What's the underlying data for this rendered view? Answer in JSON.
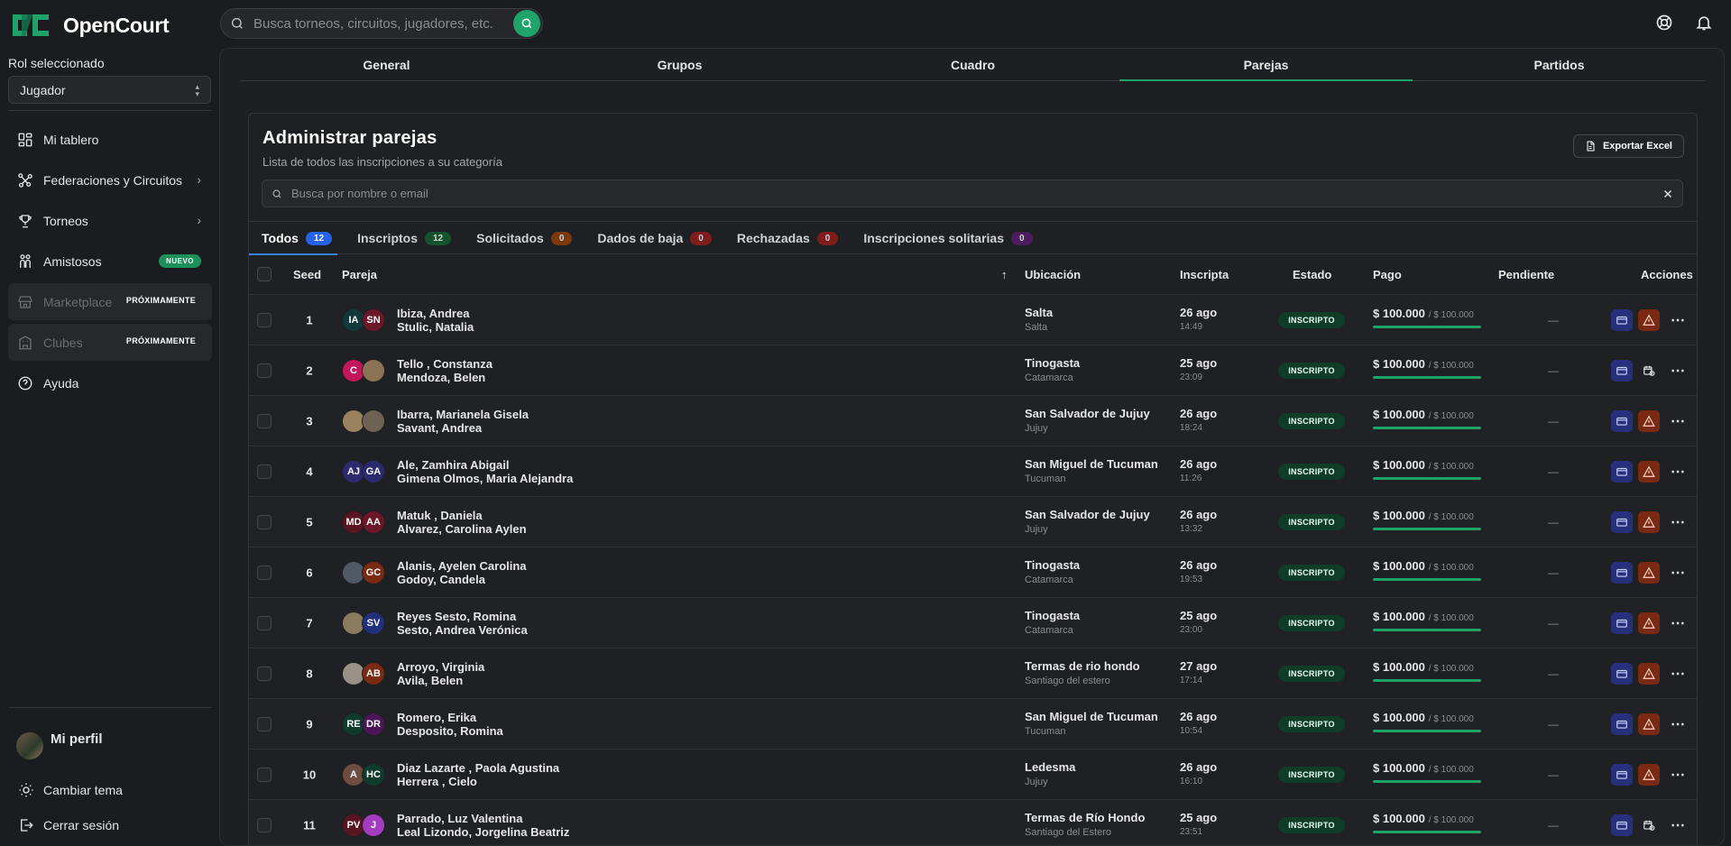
{
  "app": {
    "name": "OpenCourt"
  },
  "search": {
    "placeholder": "Busca torneos, circuitos, jugadores, etc."
  },
  "sidebar": {
    "role_label": "Rol seleccionado",
    "role_value": "Jugador",
    "items": [
      {
        "label": "Mi tablero"
      },
      {
        "label": "Federaciones y Circuitos"
      },
      {
        "label": "Torneos"
      },
      {
        "label": "Amistosos",
        "badge": "NUEVO"
      },
      {
        "label": "Marketplace",
        "badge": "PRÓXIMAMENTE"
      },
      {
        "label": "Clubes",
        "badge": "PRÓXIMAMENTE"
      },
      {
        "label": "Ayuda"
      }
    ],
    "profile": "Mi perfil",
    "theme": "Cambiar tema",
    "logout": "Cerrar sesión"
  },
  "tabs": [
    "General",
    "Grupos",
    "Cuadro",
    "Parejas",
    "Partidos"
  ],
  "card": {
    "title": "Administrar parejas",
    "subtitle": "Lista de todos las inscripciones a su categoría",
    "export": "Exportar Excel",
    "search_placeholder": "Busca por nombre o email"
  },
  "subtabs": [
    {
      "label": "Todos",
      "count": "12",
      "color": "#2563eb"
    },
    {
      "label": "Inscriptos",
      "count": "12",
      "color": "#14532d"
    },
    {
      "label": "Solicitados",
      "count": "0",
      "color": "#7c3a0a"
    },
    {
      "label": "Dados de baja",
      "count": "0",
      "color": "#7f1d1d"
    },
    {
      "label": "Rechazadas",
      "count": "0",
      "color": "#7f1d1d"
    },
    {
      "label": "Inscripciones solitarias",
      "count": "0",
      "color": "#4c1d5e"
    }
  ],
  "columns": {
    "seed": "Seed",
    "pareja": "Pareja",
    "ubicacion": "Ubicación",
    "inscripta": "Inscripta",
    "estado": "Estado",
    "pago": "Pago",
    "pendiente": "Pendiente",
    "acciones": "Acciones",
    "sort": "↑"
  },
  "rows": [
    {
      "seed": "1",
      "a1": "IA",
      "c1": "#12393a",
      "a2": "SN",
      "c2": "#6b1727",
      "n1": "Ibiza, Andrea",
      "n2": "Stulic, Natalia",
      "city": "Salta",
      "prov": "Salta",
      "date": "26 ago",
      "time": "14:49",
      "estado": "INSCRIPTO",
      "pago": "$ 100.000",
      "total": "/ $ 100.000",
      "pend": "—",
      "action2": "alert"
    },
    {
      "seed": "2",
      "a1": "C",
      "c1": "#c2185b",
      "a2": "",
      "c2": "#8d7356",
      "n1": "Tello , Constanza",
      "n2": "Mendoza, Belen",
      "city": "Tinogasta",
      "prov": "Catamarca",
      "date": "25 ago",
      "time": "23:09",
      "estado": "INSCRIPTO",
      "pago": "$ 100.000",
      "total": "/ $ 100.000",
      "pend": "—",
      "action2": "calendar"
    },
    {
      "seed": "3",
      "a1": "",
      "c1": "#9a8160",
      "a2": "",
      "c2": "#6e6352",
      "n1": "Ibarra, Marianela Gisela",
      "n2": "Savant, Andrea",
      "city": "San Salvador de Jujuy",
      "prov": "Jujuy",
      "date": "26 ago",
      "time": "18:24",
      "estado": "INSCRIPTO",
      "pago": "$ 100.000",
      "total": "/ $ 100.000",
      "pend": "—",
      "action2": "alert"
    },
    {
      "seed": "4",
      "a1": "AJ",
      "c1": "#2b2a6e",
      "a2": "GA",
      "c2": "#2b2a6e",
      "n1": "Ale, Zamhira Abigail",
      "n2": "Gimena Olmos, Maria Alejandra",
      "city": "San Miguel de Tucuman",
      "prov": "Tucuman",
      "date": "26 ago",
      "time": "11:26",
      "estado": "INSCRIPTO",
      "pago": "$ 100.000",
      "total": "/ $ 100.000",
      "pend": "—",
      "action2": "alert"
    },
    {
      "seed": "5",
      "a1": "MD",
      "c1": "#5a1520",
      "a2": "AA",
      "c2": "#6b1727",
      "n1": "Matuk , Daniela",
      "n2": "Alvarez, Carolina Aylen",
      "city": "San Salvador de Jujuy",
      "prov": "Jujuy",
      "date": "26 ago",
      "time": "13:32",
      "estado": "INSCRIPTO",
      "pago": "$ 100.000",
      "total": "/ $ 100.000",
      "pend": "—",
      "action2": "alert"
    },
    {
      "seed": "6",
      "a1": "",
      "c1": "#4f5a66",
      "a2": "GC",
      "c2": "#7a2a12",
      "n1": "Alanis, Ayelen Carolina",
      "n2": "Godoy, Candela",
      "city": "Tinogasta",
      "prov": "Catamarca",
      "date": "26 ago",
      "time": "19:53",
      "estado": "INSCRIPTO",
      "pago": "$ 100.000",
      "total": "/ $ 100.000",
      "pend": "—",
      "action2": "alert"
    },
    {
      "seed": "7",
      "a1": "",
      "c1": "#8a7a60",
      "a2": "SV",
      "c2": "#22307a",
      "n1": "Reyes Sesto, Romina",
      "n2": "Sesto, Andrea Verónica",
      "city": "Tinogasta",
      "prov": "Catamarca",
      "date": "25 ago",
      "time": "23:00",
      "estado": "INSCRIPTO",
      "pago": "$ 100.000",
      "total": "/ $ 100.000",
      "pend": "—",
      "action2": "alert"
    },
    {
      "seed": "8",
      "a1": "",
      "c1": "#9b9287",
      "a2": "AB",
      "c2": "#7a2a12",
      "n1": "Arroyo, Virginia",
      "n2": "Avila, Belen",
      "city": "Termas de rio hondo",
      "prov": "Santiago del estero",
      "date": "27 ago",
      "time": "17:14",
      "estado": "INSCRIPTO",
      "pago": "$ 100.000",
      "total": "/ $ 100.000",
      "pend": "—",
      "action2": "alert"
    },
    {
      "seed": "9",
      "a1": "RE",
      "c1": "#0f3b2c",
      "a2": "DR",
      "c2": "#4a1658",
      "n1": "Romero, Erika",
      "n2": "Desposito, Romina",
      "city": "San Miguel de Tucuman",
      "prov": "Tucuman",
      "date": "26 ago",
      "time": "10:54",
      "estado": "INSCRIPTO",
      "pago": "$ 100.000",
      "total": "/ $ 100.000",
      "pend": "—",
      "action2": "alert"
    },
    {
      "seed": "10",
      "a1": "A",
      "c1": "#6d4c41",
      "a2": "HC",
      "c2": "#0f3b2c",
      "n1": "Diaz Lazarte , Paola Agustina",
      "n2": "Herrera , Cielo",
      "city": "Ledesma",
      "prov": "Jujuy",
      "date": "26 ago",
      "time": "16:10",
      "estado": "INSCRIPTO",
      "pago": "$ 100.000",
      "total": "/ $ 100.000",
      "pend": "—",
      "action2": "alert"
    },
    {
      "seed": "11",
      "a1": "PV",
      "c1": "#5a1520",
      "a2": "J",
      "c2": "#a43cc0",
      "n1": "Parrado, Luz Valentina",
      "n2": "Leal Lizondo, Jorgelina Beatriz",
      "city": "Termas de Río Hondo",
      "prov": "Santiago del Estero",
      "date": "25 ago",
      "time": "23:51",
      "estado": "INSCRIPTO",
      "pago": "$ 100.000",
      "total": "/ $ 100.000",
      "pend": "—",
      "action2": "calendar"
    }
  ]
}
